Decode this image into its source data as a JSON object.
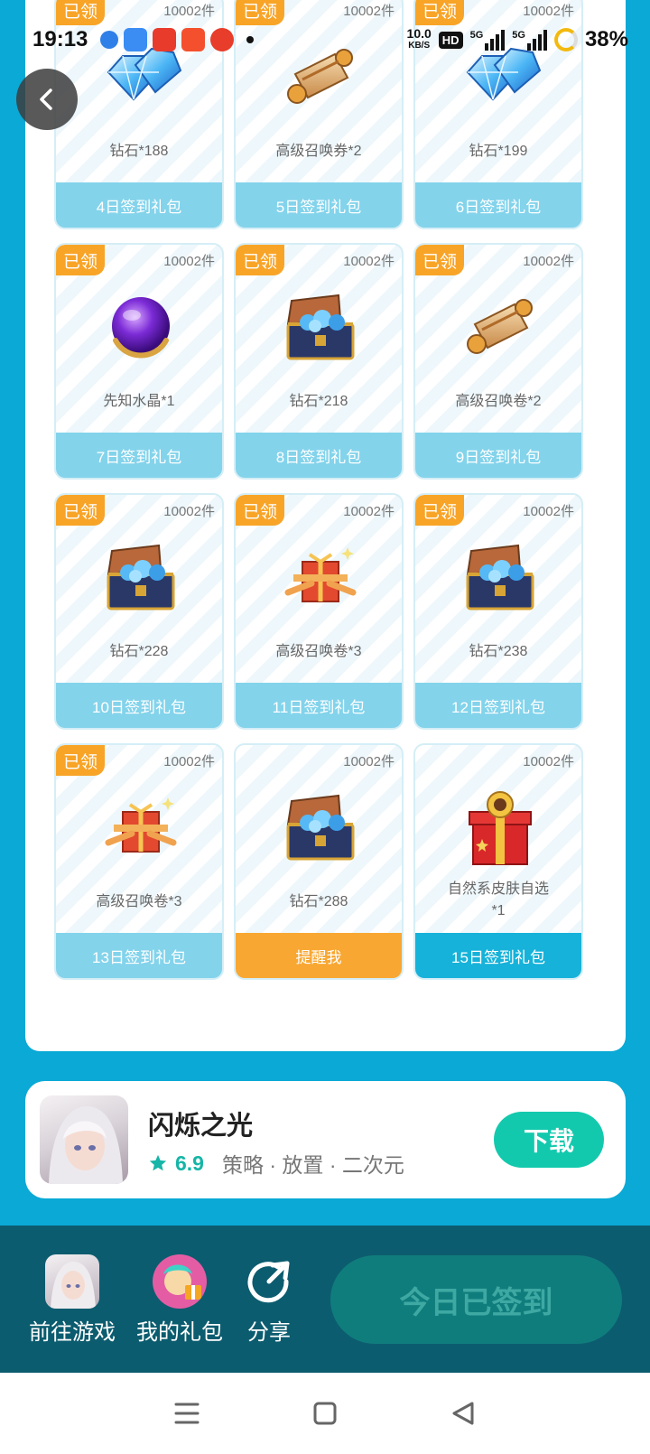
{
  "status_bar": {
    "time": "19:13",
    "net_speed": "10.0",
    "net_unit": "KB/S",
    "hd": "HD",
    "signal_1": "5G",
    "signal_2": "5G",
    "battery": "38%"
  },
  "cards": [
    {
      "day_label": "4日签到礼包",
      "item": "钻石*188",
      "count": "10002件",
      "claimed_label": "已领",
      "icon": "diamond-icon"
    },
    {
      "day_label": "5日签到礼包",
      "item": "高级召唤券*2",
      "count": "10002件",
      "claimed_label": "已领",
      "icon": "scroll-icon"
    },
    {
      "day_label": "6日签到礼包",
      "item": "钻石*199",
      "count": "10002件",
      "claimed_label": "已领",
      "icon": "diamond-icon"
    },
    {
      "day_label": "7日签到礼包",
      "item": "先知水晶*1",
      "count": "10002件",
      "claimed_label": "已领",
      "icon": "crystal-orb-icon"
    },
    {
      "day_label": "8日签到礼包",
      "item": "钻石*218",
      "count": "10002件",
      "claimed_label": "已领",
      "icon": "treasure-chest-icon"
    },
    {
      "day_label": "9日签到礼包",
      "item": "高级召唤卷*2",
      "count": "10002件",
      "claimed_label": "已领",
      "icon": "scroll-icon"
    },
    {
      "day_label": "10日签到礼包",
      "item": "钻石*228",
      "count": "10002件",
      "claimed_label": "已领",
      "icon": "treasure-chest-icon"
    },
    {
      "day_label": "11日签到礼包",
      "item": "高级召唤卷*3",
      "count": "10002件",
      "claimed_label": "已领",
      "icon": "scroll-bundle-icon"
    },
    {
      "day_label": "12日签到礼包",
      "item": "钻石*238",
      "count": "10002件",
      "claimed_label": "已领",
      "icon": "treasure-chest-icon"
    },
    {
      "day_label": "13日签到礼包",
      "item": "高级召唤卷*3",
      "count": "10002件",
      "claimed_label": "已领",
      "icon": "scroll-bundle-icon"
    },
    {
      "day_label": "提醒我",
      "item": "钻石*288",
      "count": "10002件",
      "claimed_label": "",
      "icon": "treasure-chest-icon"
    },
    {
      "day_label": "15日签到礼包",
      "item": "自然系皮肤自选\n*1",
      "count": "10002件",
      "claimed_label": "",
      "icon": "gift-box-icon"
    }
  ],
  "game": {
    "title": "闪烁之光",
    "score": "6.9",
    "tags": "策略 · 放置 · 二次元",
    "download_label": "下载"
  },
  "bottom_bar": {
    "go_game_label": "前往游戏",
    "my_gifts_label": "我的礼包",
    "share_label": "分享",
    "checkin_label": "今日已签到"
  },
  "colors": {
    "background": "#0aa9d6",
    "claimed_badge": "#f8a427",
    "card_footer": "#83d3eb",
    "remind_button": "#f8a732",
    "download_button": "#13c9ad",
    "bottom_bar": "#0c5c6f"
  }
}
